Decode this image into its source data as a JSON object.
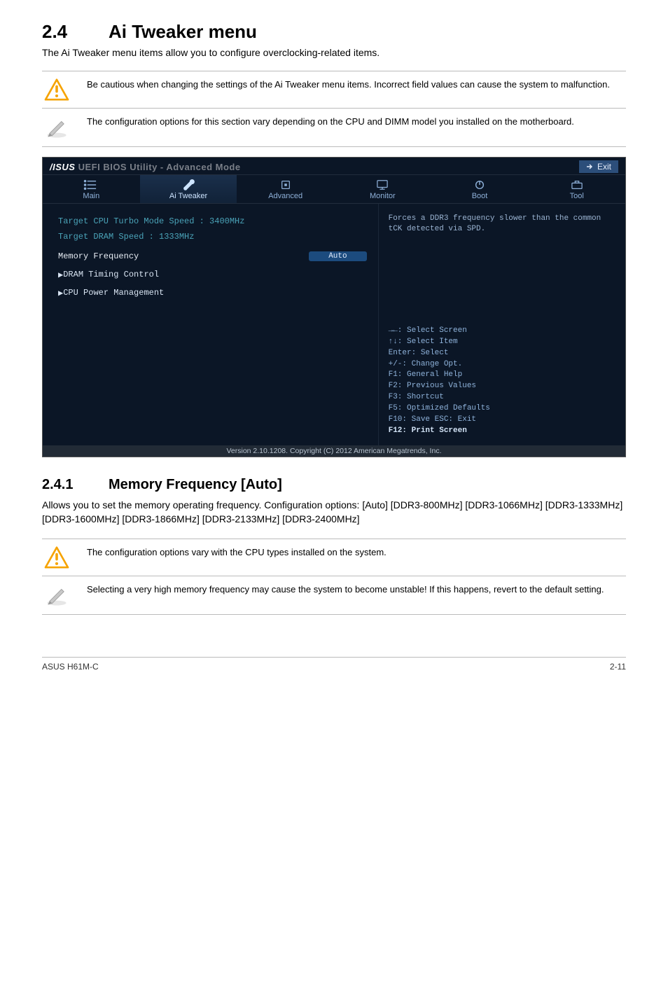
{
  "section": {
    "num": "2.4",
    "title": "Ai Tweaker menu"
  },
  "lead": "The Ai Tweaker menu items allow you to configure overclocking-related items.",
  "warn1": "Be cautious when changing the settings of the Ai Tweaker menu items. Incorrect field values can cause the system to malfunction.",
  "note1": "The configuration options for this section vary depending on the CPU and DIMM model you installed on the motherboard.",
  "bios": {
    "titlebar": "UEFI BIOS Utility - Advanced Mode",
    "exit": "Exit",
    "tabs": {
      "main": "Main",
      "ai": "Ai Tweaker",
      "adv": "Advanced",
      "mon": "Monitor",
      "boot": "Boot",
      "tool": "Tool"
    },
    "rows": {
      "cpu_label": "Target CPU Turbo Mode Speed : 3400MHz",
      "dram_label": "Target DRAM Speed : 1333MHz",
      "memfreq_label": "Memory Frequency",
      "memfreq_val": "Auto",
      "timing": "DRAM Timing Control",
      "power": "CPU Power Management"
    },
    "sidehelp": "Forces a DDR3 frequency slower than the common tCK detected via SPD.",
    "keys": {
      "k1": "→←: Select Screen",
      "k2": "↑↓: Select Item",
      "k3": "Enter: Select",
      "k4": "+/-: Change Opt.",
      "k5": "F1: General Help",
      "k6": "F2: Previous Values",
      "k7": "F3: Shortcut",
      "k8": "F5: Optimized Defaults",
      "k9": "F10: Save  ESC: Exit",
      "k10_label": "F12: Print Screen"
    },
    "footer": "Version 2.10.1208. Copyright (C) 2012 American Megatrends, Inc."
  },
  "subsection": {
    "num": "2.4.1",
    "title": "Memory Frequency [Auto]"
  },
  "subbody": "Allows you to set the memory operating frequency. Configuration options: [Auto] [DDR3-800MHz] [DDR3-1066MHz] [DDR3-1333MHz] [DDR3-1600MHz] [DDR3-1866MHz] [DDR3-2133MHz] [DDR3-2400MHz]",
  "warn2": "The configuration options vary with the CPU types installed on the system.",
  "note2": "Selecting a very high memory frequency may cause the system to become unstable! If this happens, revert to the default setting.",
  "footer": {
    "left": "ASUS H61M-C",
    "right": "2-11"
  }
}
